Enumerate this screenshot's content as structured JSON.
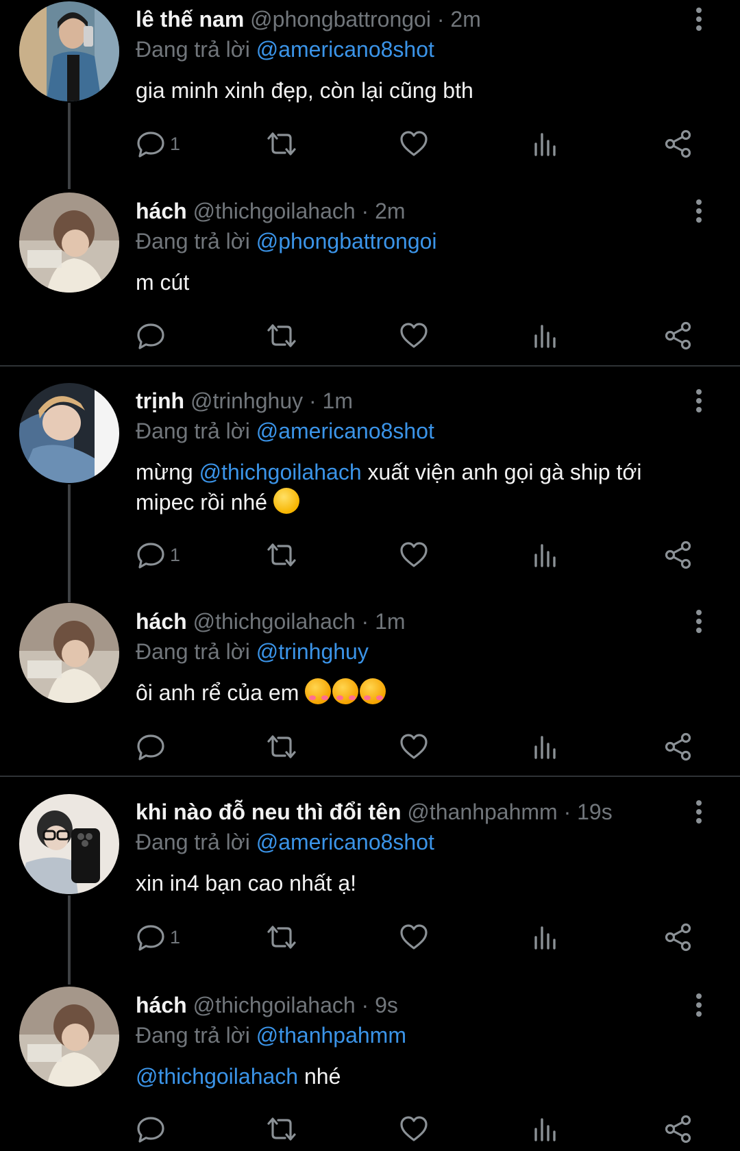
{
  "replies": [
    {
      "name": "lê thế nam",
      "handle": "@phongbattrongoi",
      "time": "· 2m",
      "reply_prefix": "Đang trả lời",
      "reply_to": "@americano8shot",
      "text": "gia minh xinh đẹp, còn lại cũng bth",
      "reply_count": "1"
    },
    {
      "name": "hách",
      "handle": "@thichgoilahach",
      "time": "· 2m",
      "reply_prefix": "Đang trả lời",
      "reply_to": "@phongbattrongoi",
      "text": "m cút",
      "reply_count": ""
    },
    {
      "name": "trịnh",
      "handle": "@trinhghuy",
      "time": "· 1m",
      "reply_prefix": "Đang trả lời",
      "reply_to": "@americano8shot",
      "text_before": "mừng",
      "text_mention": "@thichgoilahach",
      "text_after": "xuất viện anh gọi gà ship tới",
      "text_line2": "mipec rồi nhé",
      "reply_count": "1"
    },
    {
      "name": "hách",
      "handle": "@thichgoilahach",
      "time": "· 1m",
      "reply_prefix": "Đang trả lời",
      "reply_to": "@trinhghuy",
      "text": "ôi anh rể của em",
      "reply_count": ""
    },
    {
      "name": "khi nào đỗ neu thì đổi tên",
      "handle": "@thanhpahmm",
      "time": "· 19s",
      "reply_prefix": "Đang trả lời",
      "reply_to": "@americano8shot",
      "text": "xin in4 bạn cao nhất ạ!",
      "reply_count": "1"
    },
    {
      "name": "hách",
      "handle": "@thichgoilahach",
      "time": "· 9s",
      "reply_prefix": "Đang trả lời",
      "reply_to": "@thanhpahmm",
      "text_mention": "@thichgoilahach",
      "text_after": "nhé",
      "reply_count": ""
    }
  ],
  "icons": [
    "reply-icon",
    "retweet-icon",
    "like-icon",
    "views-icon",
    "share-icon",
    "more-icon"
  ],
  "colors": {
    "background": "#000000",
    "text": "#f2f2f2",
    "muted": "#71767b",
    "link": "#3b94e8",
    "divider": "#2f3336",
    "thread_line": "#3e4144"
  }
}
